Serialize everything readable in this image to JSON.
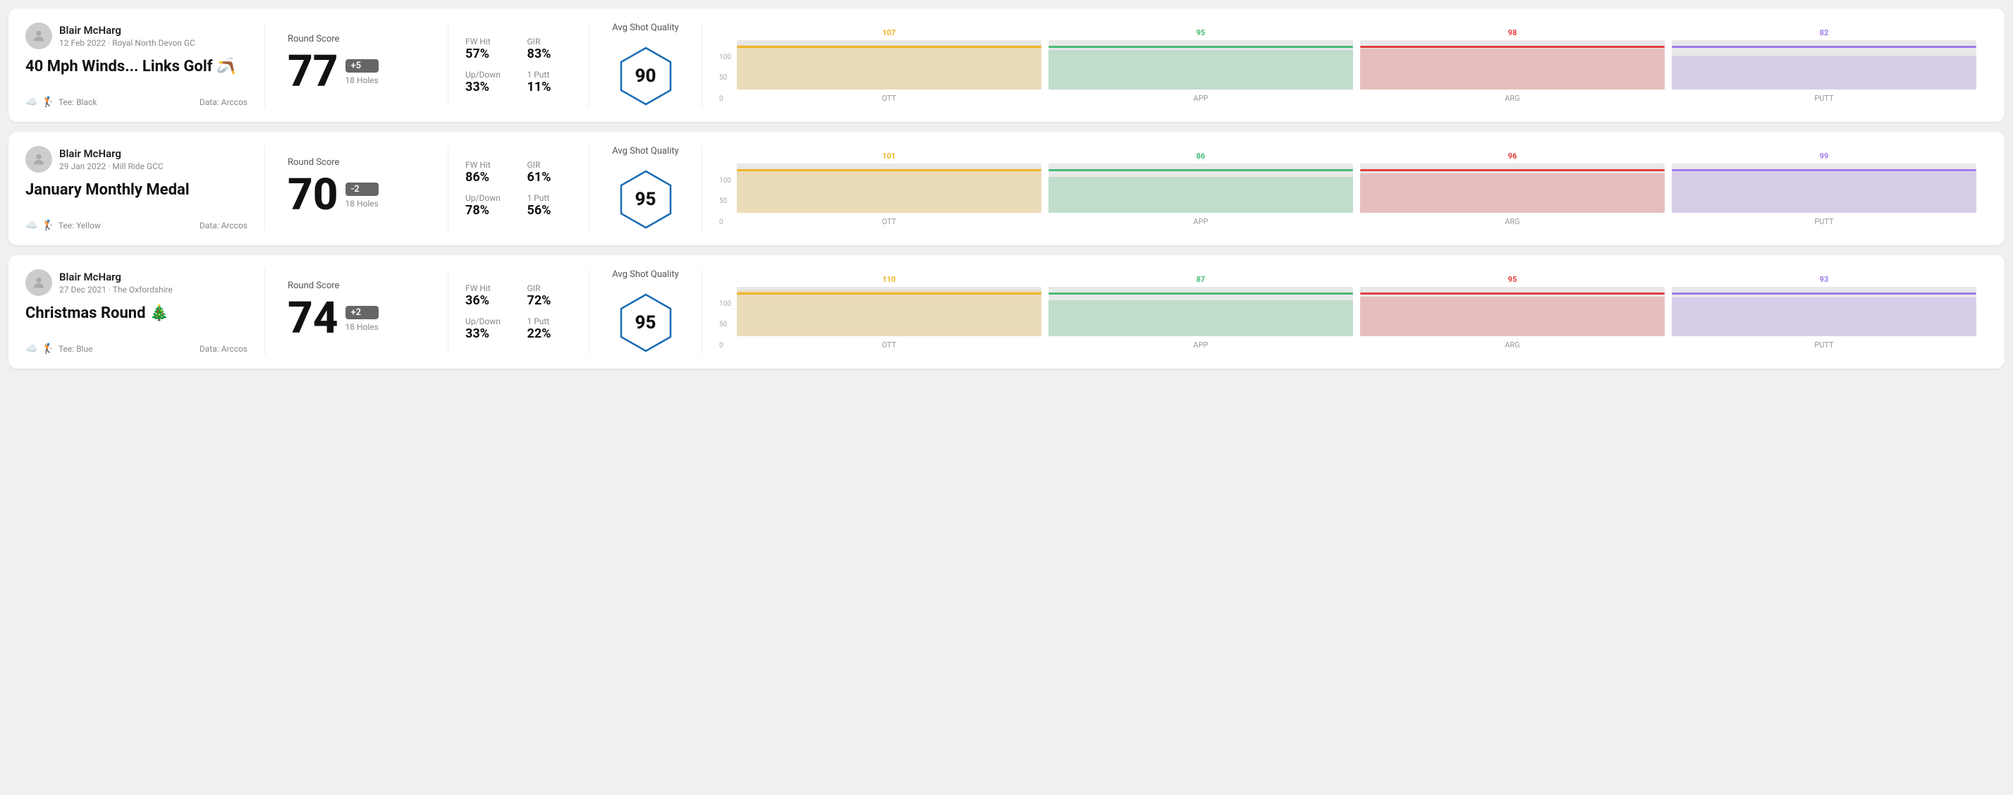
{
  "rounds": [
    {
      "id": "round1",
      "player_name": "Blair McHarg",
      "player_meta": "12 Feb 2022 · Royal North Devon GC",
      "round_title": "40 Mph Winds... Links Golf 🪃",
      "tee": "Black",
      "data_source": "Data: Arccos",
      "round_score_label": "Round Score",
      "score": "77",
      "score_diff": "+5",
      "holes": "18 Holes",
      "fw_hit_label": "FW Hit",
      "fw_hit": "57%",
      "gir_label": "GIR",
      "gir": "83%",
      "updown_label": "Up/Down",
      "updown": "33%",
      "oneputt_label": "1 Putt",
      "oneputt": "11%",
      "avg_quality_label": "Avg Shot Quality",
      "quality_score": "90",
      "chart_cols": [
        {
          "label": "OTT",
          "value": 107,
          "color": "#f0b429"
        },
        {
          "label": "APP",
          "value": 95,
          "color": "#48bb78"
        },
        {
          "label": "ARG",
          "value": 98,
          "color": "#e53e3e"
        },
        {
          "label": "PUTT",
          "value": 82,
          "color": "#9f7aea"
        }
      ]
    },
    {
      "id": "round2",
      "player_name": "Blair McHarg",
      "player_meta": "29 Jan 2022 · Mill Ride GCC",
      "round_title": "January Monthly Medal",
      "tee": "Yellow",
      "data_source": "Data: Arccos",
      "round_score_label": "Round Score",
      "score": "70",
      "score_diff": "-2",
      "holes": "18 Holes",
      "fw_hit_label": "FW Hit",
      "fw_hit": "86%",
      "gir_label": "GIR",
      "gir": "61%",
      "updown_label": "Up/Down",
      "updown": "78%",
      "oneputt_label": "1 Putt",
      "oneputt": "56%",
      "avg_quality_label": "Avg Shot Quality",
      "quality_score": "95",
      "chart_cols": [
        {
          "label": "OTT",
          "value": 101,
          "color": "#f0b429"
        },
        {
          "label": "APP",
          "value": 86,
          "color": "#48bb78"
        },
        {
          "label": "ARG",
          "value": 96,
          "color": "#e53e3e"
        },
        {
          "label": "PUTT",
          "value": 99,
          "color": "#9f7aea"
        }
      ]
    },
    {
      "id": "round3",
      "player_name": "Blair McHarg",
      "player_meta": "27 Dec 2021 · The Oxfordshire",
      "round_title": "Christmas Round 🎄",
      "tee": "Blue",
      "data_source": "Data: Arccos",
      "round_score_label": "Round Score",
      "score": "74",
      "score_diff": "+2",
      "holes": "18 Holes",
      "fw_hit_label": "FW Hit",
      "fw_hit": "36%",
      "gir_label": "GIR",
      "gir": "72%",
      "updown_label": "Up/Down",
      "updown": "33%",
      "oneputt_label": "1 Putt",
      "oneputt": "22%",
      "avg_quality_label": "Avg Shot Quality",
      "quality_score": "95",
      "chart_cols": [
        {
          "label": "OTT",
          "value": 110,
          "color": "#f0b429"
        },
        {
          "label": "APP",
          "value": 87,
          "color": "#48bb78"
        },
        {
          "label": "ARG",
          "value": 95,
          "color": "#e53e3e"
        },
        {
          "label": "PUTT",
          "value": 93,
          "color": "#9f7aea"
        }
      ]
    }
  ],
  "chart_y_labels": [
    "100",
    "50",
    "0"
  ]
}
